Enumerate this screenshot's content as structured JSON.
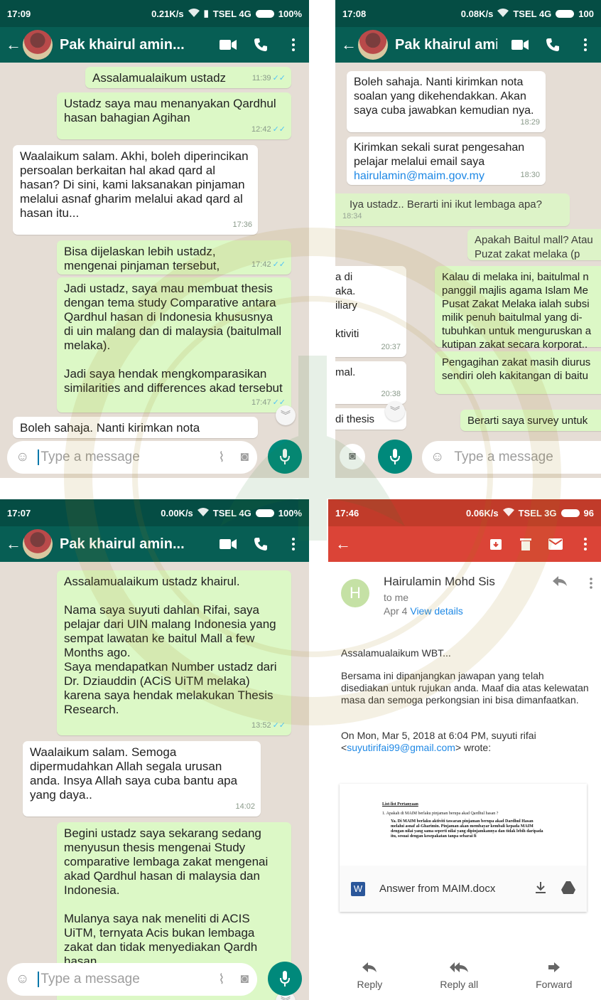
{
  "panel1": {
    "status": {
      "time": "17:09",
      "speed": "0.21K/s",
      "carrier": "TSEL 4G",
      "battery": "100%"
    },
    "contact_name": "Pak khairul amin...",
    "messages": [
      {
        "text": "Assalamualaikum ustadz",
        "time": "11:39",
        "dir": "out"
      },
      {
        "text": "Ustadz saya mau menanyakan Qardhul hasan bahagian Agihan",
        "time": "12:42",
        "dir": "out"
      },
      {
        "text": "Waalaikum salam. Akhi, boleh diperincikan persoalan berkaitan hal akad qard al hasan? Di sini, kami laksanakan pinjaman melalui asnaf gharim melalui akad qard al hasan itu...",
        "time": "17:36",
        "dir": "in"
      },
      {
        "text": "Bisa dijelaskan lebih ustadz, mengenai pinjaman tersebut,",
        "time": "17:42",
        "dir": "out"
      },
      {
        "text": "Jadi ustadz, saya mau membuat thesis dengan tema study Comparative antara Qardhul hasan di Indonesia khususnya di uin malang dan di malaysia (baitulmall melaka).\n\nJadi saya hendak mengkomparasikan similarities and differences akad tersebut",
        "time": "17:47",
        "dir": "out"
      },
      {
        "text": "Boleh sahaja. Nanti kirimkan nota",
        "time": "",
        "dir": "in"
      }
    ],
    "input_placeholder": "Type a message"
  },
  "panel2": {
    "status": {
      "time": "17:08",
      "speed": "0.08K/s",
      "carrier": "TSEL 4G",
      "battery": "100"
    },
    "contact_name": "Pak khairul amin...",
    "messages": [
      {
        "text": "Boleh sahaja. Nanti kirimkan nota soalan yang dikehendakkan. Akan saya cuba jawabkan kemudian nya.",
        "time": "18:29"
      },
      {
        "text": "Kirimkan sekali surat pengesahan pelajar melalui email saya",
        "link": "hairulamin@maim.gov.my",
        "time": "18:30"
      },
      {
        "text": "Iya ustadz.. Berarti ini ikut lembaga apa?",
        "time": "18:34"
      },
      {
        "text": "Apakah Baitul mall? Atau Puzat zakat melaka (p",
        "time": ""
      },
      {
        "text": "a di\naka.\niliary\n\nktiviti",
        "time": "20:37"
      },
      {
        "text": "Kalau di melaka ini, baitulmal n panggil majlis agama Islam Me Pusat Zakat Melaka ialah subsi milik penuh baitulmal yang di- tubuhkan untuk menguruskan a kutipan zakat secara korporat..",
        "time": ""
      },
      {
        "text": "Pengagihan zakat masih diurus sendiri oleh kakitangan di baitu",
        "time": ""
      },
      {
        "text": "mal.",
        "time": "20:38"
      },
      {
        "text": "di thesis",
        "time": ""
      },
      {
        "text": "Berarti saya survey untuk",
        "time": ""
      }
    ],
    "input_placeholder": "Type a message"
  },
  "panel3": {
    "status": {
      "time": "17:07",
      "speed": "0.00K/s",
      "carrier": "TSEL 4G",
      "battery": "100%"
    },
    "contact_name": "Pak khairul amin...",
    "messages": [
      {
        "text": "Assalamualaikum ustadz khairul.\n\nNama saya suyuti dahlan Rifai, saya pelajar dari UIN malang Indonesia yang sempat lawatan ke baitul Mall a few Months ago.\nSaya mendapatkan Number ustadz dari Dr. Dziauddin (ACiS UiTM melaka) karena saya hendak melakukan Thesis Research.",
        "time": "13:52",
        "dir": "out"
      },
      {
        "text": "Waalaikum salam. Semoga dipermudahkan Allah segala urusan anda. Insya Allah saya cuba bantu apa yang daya..",
        "time": "14:02",
        "dir": "in"
      },
      {
        "text": "Begini ustadz saya sekarang sedang menyusun thesis mengenai Study comparative lembaga zakat mengenai akad Qardhul hasan di malaysia dan Indonesia.\n\nMulanya saya nak meneliti di ACIS UiTM, ternyata Acis bukan lembaga zakat dan tidak menyediakan Qardh hasan.",
        "time": "",
        "dir": "out"
      }
    ],
    "input_placeholder": "Type a message"
  },
  "panel4": {
    "status": {
      "time": "17:46",
      "speed": "0.06K/s",
      "carrier": "TSEL 3G",
      "battery": "96"
    },
    "avatar_letter": "H",
    "sender": "Hairulamin Mohd Sis",
    "to": "to me",
    "date": "Apr 4",
    "view_details": "View details",
    "greeting": "Assalamualaikum WBT...",
    "body": "Bersama ini dipanjangkan jawapan yang telah disediakan untuk rujukan anda. Maaf dia atas kelewatan masa dan semoga perkongsian ini bisa dimanfaatkan.",
    "quote_prefix": "On Mon, Mar 5, 2018 at 6:04 PM, suyuti rifai",
    "quote_email": "suyutirifai99@gmail.com",
    "quote_suffix": "> wrote:",
    "attachment": {
      "preview_title": "List-list Pertanyaan",
      "preview_q": "1.  Apakah di MAIM berlaku pinjaman berupa akad Qardhul hasan ?",
      "preview_a": "Ya. Di MAIM berlaku aktiviti tawaran pinjaman berupa akad Dardhul Hasan melalui asnaf al-Gharimin. Pinjaman akan membayar kembali kepada MAIM dengan nilai yang sama seperti nilai yang dipinjamkannya dan tidak lebih daripada itu, sesuai dengan kesepakatan tanpa sebarai fi",
      "name": "Answer from MAIM.docx",
      "badge": "W"
    },
    "actions": {
      "reply": "Reply",
      "reply_all": "Reply all",
      "forward": "Forward"
    }
  }
}
